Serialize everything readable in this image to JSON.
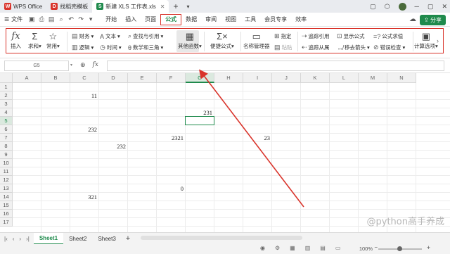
{
  "titlebar": {
    "tabs": [
      {
        "label": "WPS Office",
        "color": "#d9342b",
        "glyph": "W"
      },
      {
        "label": "找稻壳模板",
        "color": "#d9342b",
        "glyph": "D"
      },
      {
        "label": "新建 XLS 工作表.xls",
        "color": "#1f8a4c",
        "glyph": "S"
      }
    ]
  },
  "menubar": {
    "file": "文件",
    "items": [
      "开始",
      "插入",
      "页面",
      "公式",
      "数据",
      "审阅",
      "视图",
      "工具",
      "会员专享",
      "效率"
    ],
    "current": "公式",
    "share": "分享"
  },
  "ribbon": {
    "insert": "插入",
    "sum": "求和",
    "common": "常用",
    "finance": "财务",
    "logic": "逻辑",
    "text": "文本",
    "time": "时间",
    "lookup": "查找与引用",
    "math": "数学和三角",
    "other": "其他函数",
    "quick": "便捷公式",
    "name_mgr": "名称管理器",
    "specify": "指定",
    "paste": "粘贴",
    "trace_prec": "追踪引用",
    "trace_dep": "追踪从属",
    "show_formula": "显示公式",
    "remove_arrows": "移去箭头",
    "eval_formula": "公式求值",
    "error_check": "错误检查",
    "calc_options": "计算选项"
  },
  "formula_bar": {
    "name_box": "G5",
    "fx": "fx",
    "value": ""
  },
  "grid": {
    "columns": [
      "A",
      "B",
      "C",
      "D",
      "E",
      "F",
      "G",
      "H",
      "I",
      "J",
      "K",
      "L",
      "M",
      "N"
    ],
    "rows": [
      "1",
      "2",
      "3",
      "4",
      "5",
      "6",
      "7",
      "8",
      "9",
      "10",
      "11",
      "12",
      "13",
      "14",
      "15",
      "16",
      "17"
    ],
    "selected_cell": "G5",
    "cells": [
      {
        "ref": "C2",
        "value": "11"
      },
      {
        "ref": "G4",
        "value": "231"
      },
      {
        "ref": "C6",
        "value": "232"
      },
      {
        "ref": "F7",
        "value": "2321"
      },
      {
        "ref": "I7",
        "value": "23"
      },
      {
        "ref": "D8",
        "value": "232"
      },
      {
        "ref": "F13",
        "value": "0"
      },
      {
        "ref": "C14",
        "value": "321"
      }
    ]
  },
  "sheets": {
    "tabs": [
      "Sheet1",
      "Sheet2",
      "Sheet3"
    ],
    "active": "Sheet1"
  },
  "status": {
    "zoom": "100%"
  },
  "watermark": "@python高手养成",
  "accent": "#1f8a4c",
  "annotation_color": "#d9342b"
}
